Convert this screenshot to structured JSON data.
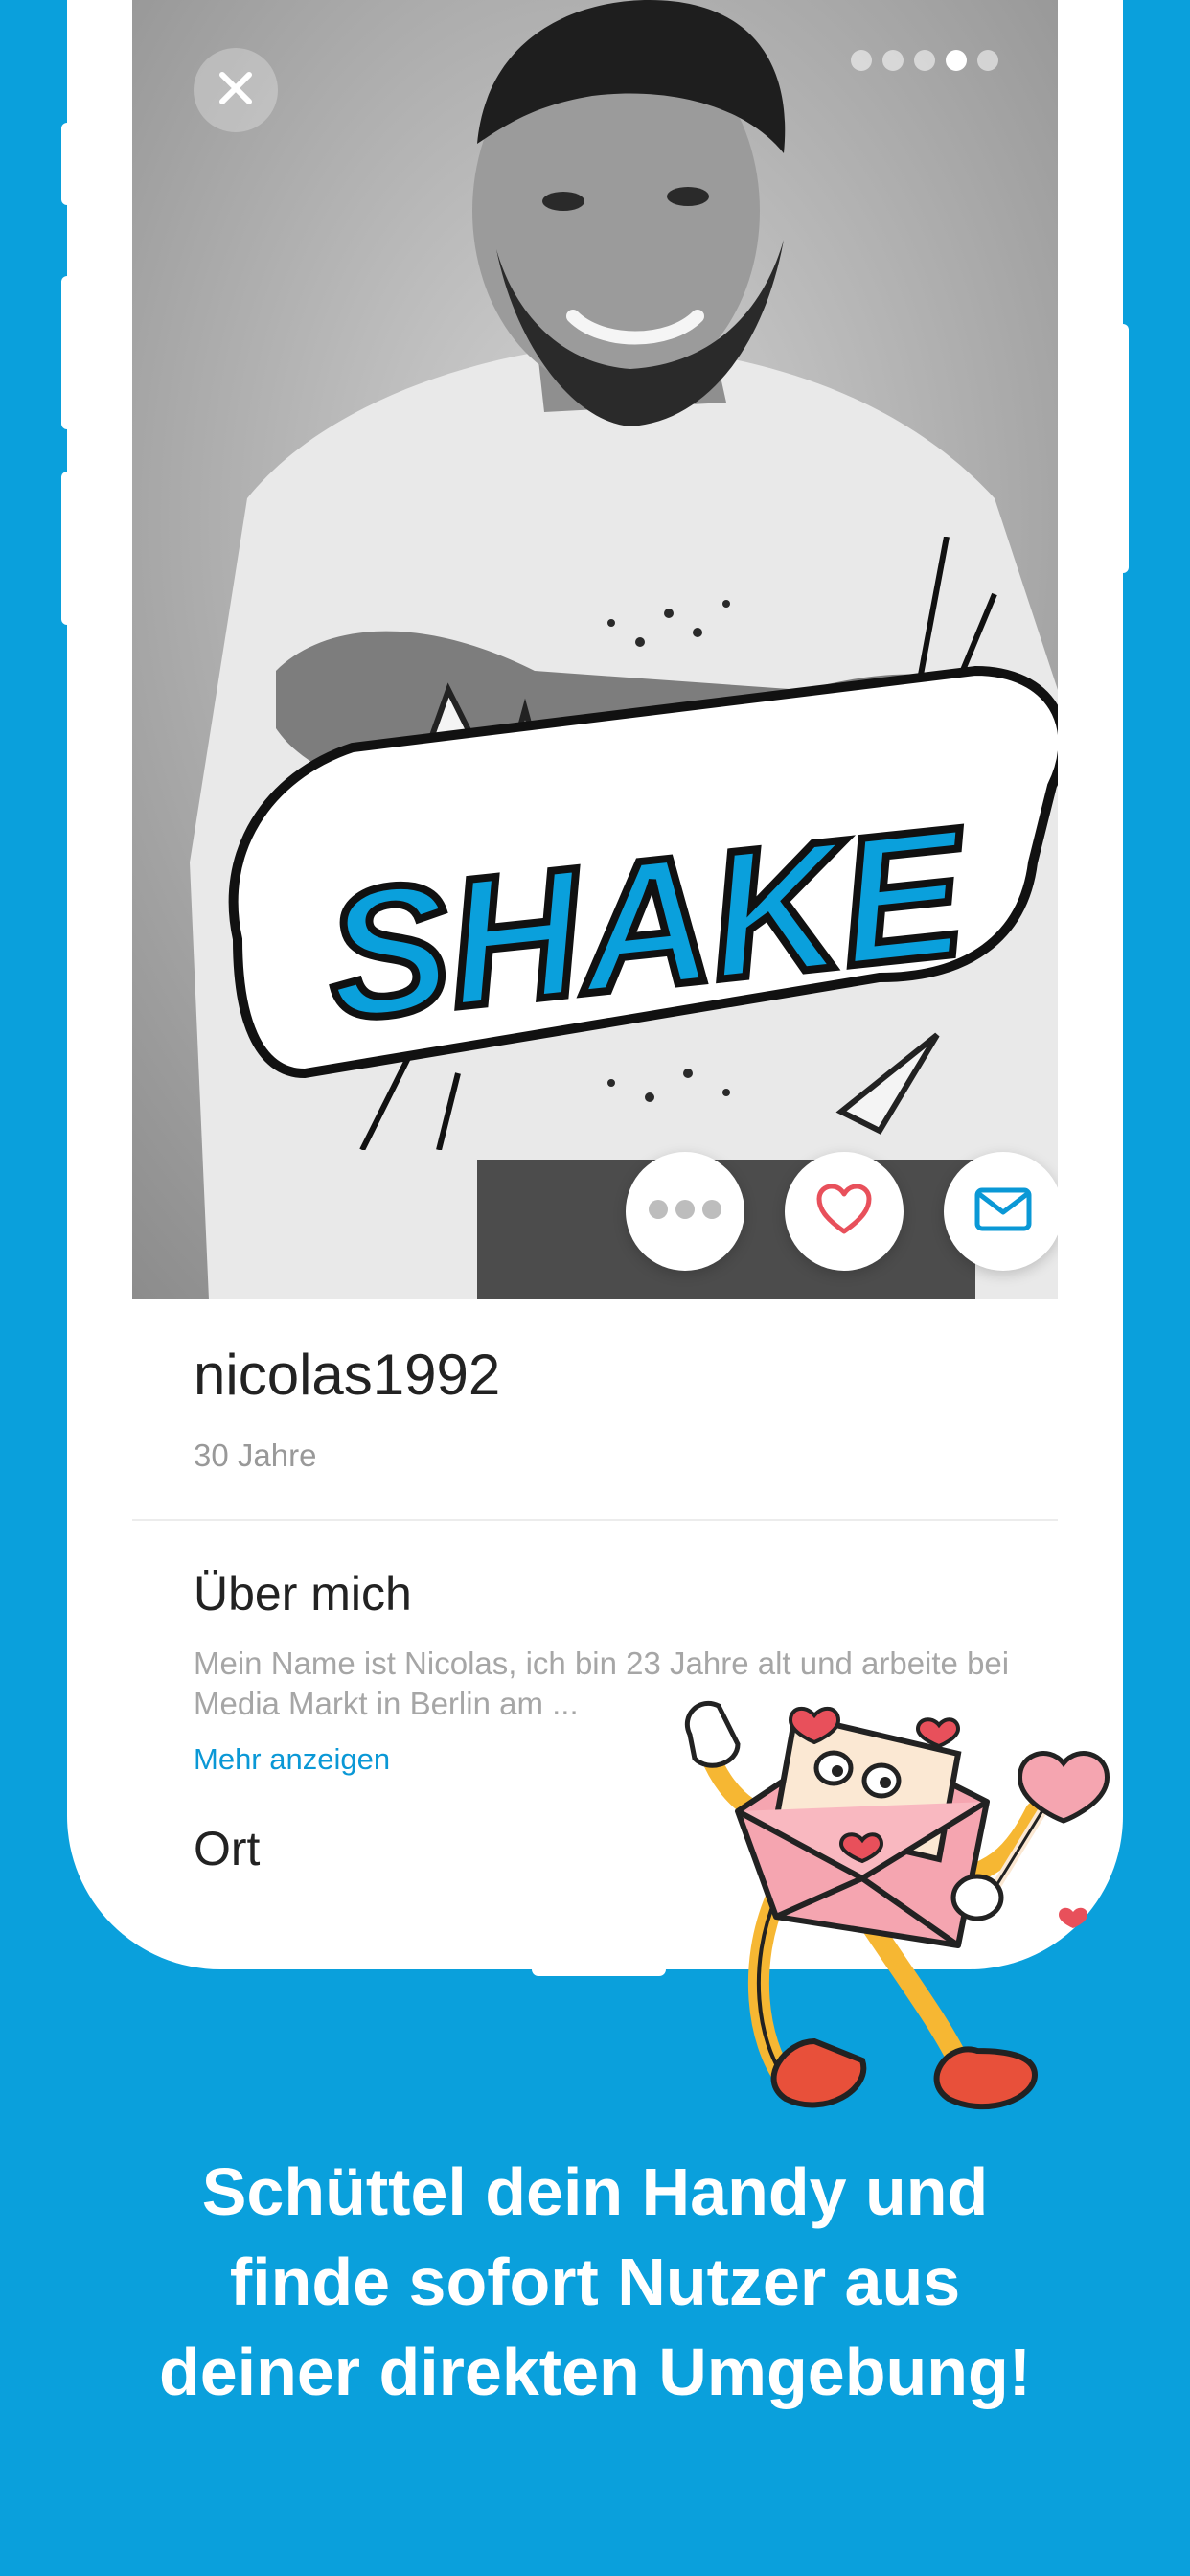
{
  "profile": {
    "username": "nicolas1992",
    "age": "30 Jahre",
    "photo_count": 5,
    "photo_active_index": 3
  },
  "photo_overlay": {
    "sticker_text": "SHAKE"
  },
  "icons": {
    "close": "close-icon",
    "more": "more-dots-icon",
    "like": "heart-icon",
    "message": "envelope-icon"
  },
  "about": {
    "heading": "Über mich",
    "text": "Mein Name ist Nicolas, ich bin 23 Jahre alt und arbeite bei Media Markt in Berlin am ...",
    "more_label": "Mehr anzeigen"
  },
  "location": {
    "heading": "Ort"
  },
  "headline": {
    "line1": "Schüttel dein Handy und",
    "line2": "finde sofort Nutzer aus",
    "line3": "deiner direkten Umgebung!"
  },
  "colors": {
    "brand_blue": "#0aa0dc",
    "like_red": "#e8505b",
    "link_blue": "#0a98d6"
  }
}
